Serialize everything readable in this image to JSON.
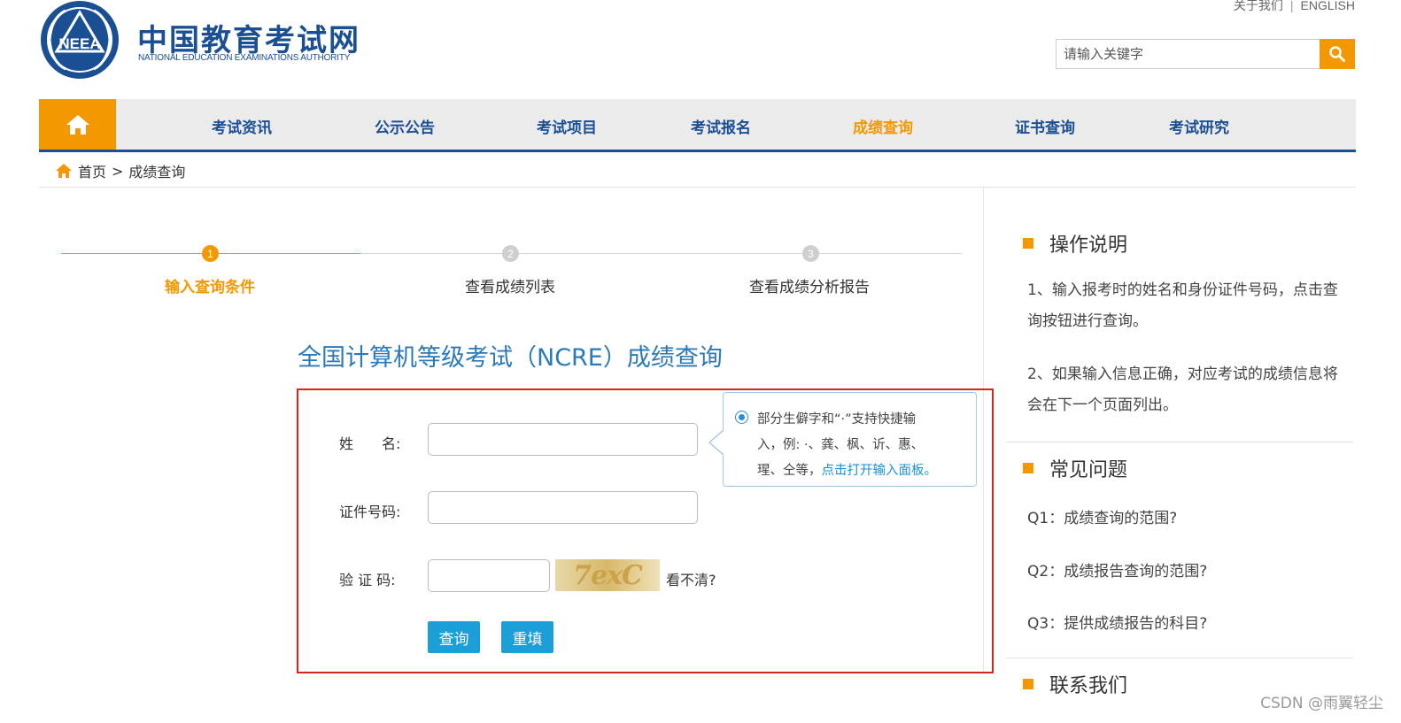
{
  "header": {
    "logo_title": "中国教育考试网",
    "logo_subtitle": "NATIONAL EDUCATION EXAMINATIONS AUTHORITY",
    "logo_emblem_text": "NEEA",
    "top_links": [
      "关于我们",
      "ENGLISH"
    ],
    "search_placeholder": "请输入关键字"
  },
  "nav": {
    "items": [
      "考试资讯",
      "公示公告",
      "考试项目",
      "考试报名",
      "成绩查询",
      "证书查询",
      "考试研究"
    ],
    "active": "成绩查询"
  },
  "breadcrumb": {
    "home": "首页",
    "separator": ">",
    "current": "成绩查询"
  },
  "steps": [
    {
      "num": "1",
      "label": "输入查询条件",
      "active": true
    },
    {
      "num": "2",
      "label": "查看成绩列表",
      "active": false
    },
    {
      "num": "3",
      "label": "查看成绩分析报告",
      "active": false
    }
  ],
  "form": {
    "title": "全国计算机等级考试（NCRE）成绩查询",
    "name_label": "姓　　名:",
    "id_label": "证件号码:",
    "captcha_label": "验 证 码:",
    "captcha_text": "7exC",
    "captcha_refresh": "看不清?",
    "query_button": "查询",
    "reset_button": "重填"
  },
  "tip": {
    "line1": "部分生僻字和“·”支持快捷输",
    "line2": "入，例: ·、龚、枫、䜣、惠、",
    "line3_prefix": "瑆、仝等，",
    "link": "点击打开输入面板。"
  },
  "sidebar": {
    "section1_title": "操作说明",
    "instructions": [
      "1、输入报考时的姓名和身份证件号码，点击查询按钮进行查询。",
      "2、如果输入信息正确，对应考试的成绩信息将会在下一个页面列出。"
    ],
    "section2_title": "常见问题",
    "faqs": [
      "Q1：成绩查询的范围?",
      "Q2：成绩报告查询的范围?",
      "Q3：提供成绩报告的科目?"
    ],
    "section3_title": "联系我们"
  },
  "watermark": "CSDN @雨翼轻尘",
  "colors": {
    "brand_blue": "#1b4f94",
    "accent_orange": "#f39800",
    "button_blue": "#1a9fd9",
    "form_border_red": "#d9241b"
  }
}
